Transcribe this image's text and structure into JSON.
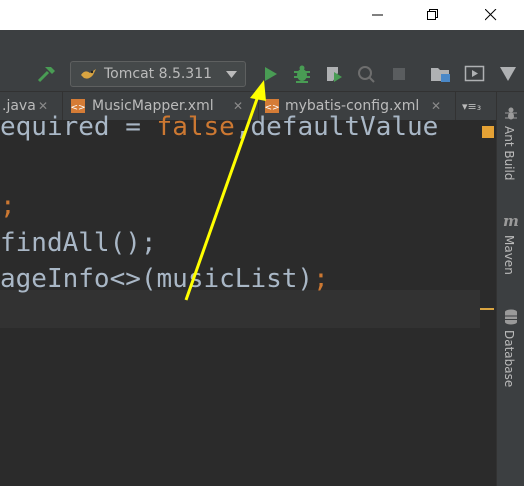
{
  "window": {
    "controls": [
      "minimize",
      "maximize",
      "close"
    ]
  },
  "toolbar": {
    "run_config": "Tomcat 8.5.311",
    "icons": [
      "hammer-icon",
      "run-icon",
      "debug-icon",
      "coverage-icon",
      "profile-icon",
      "stop-icon",
      "project-structure-icon",
      "presentation-icon"
    ]
  },
  "tabs": [
    {
      "label": ".java"
    },
    {
      "label": "MusicMapper.xml"
    },
    {
      "label": "mybatis-config.xml"
    },
    {
      "label": "▾≡₃"
    }
  ],
  "editor": {
    "lines": [
      {
        "parts": [
          {
            "text": "equired = ",
            "c": "default"
          },
          {
            "text": "false",
            "c": "kw"
          },
          {
            "text": ",defaultValue",
            "c": "default"
          }
        ]
      },
      {
        "parts": [
          {
            "text": ";",
            "c": "kw"
          }
        ]
      },
      {
        "parts": [
          {
            "text": "findAll();",
            "c": "default"
          }
        ]
      },
      {
        "parts": [
          {
            "text": "ageInfo<>(musicList)",
            "c": "default"
          },
          {
            "text": ";",
            "c": "kw"
          }
        ]
      }
    ]
  },
  "sidebar": {
    "items": [
      {
        "label": "Ant Build"
      },
      {
        "label": "Maven"
      },
      {
        "label": "Database"
      }
    ]
  },
  "annotation": {
    "color": "#ffff00"
  }
}
